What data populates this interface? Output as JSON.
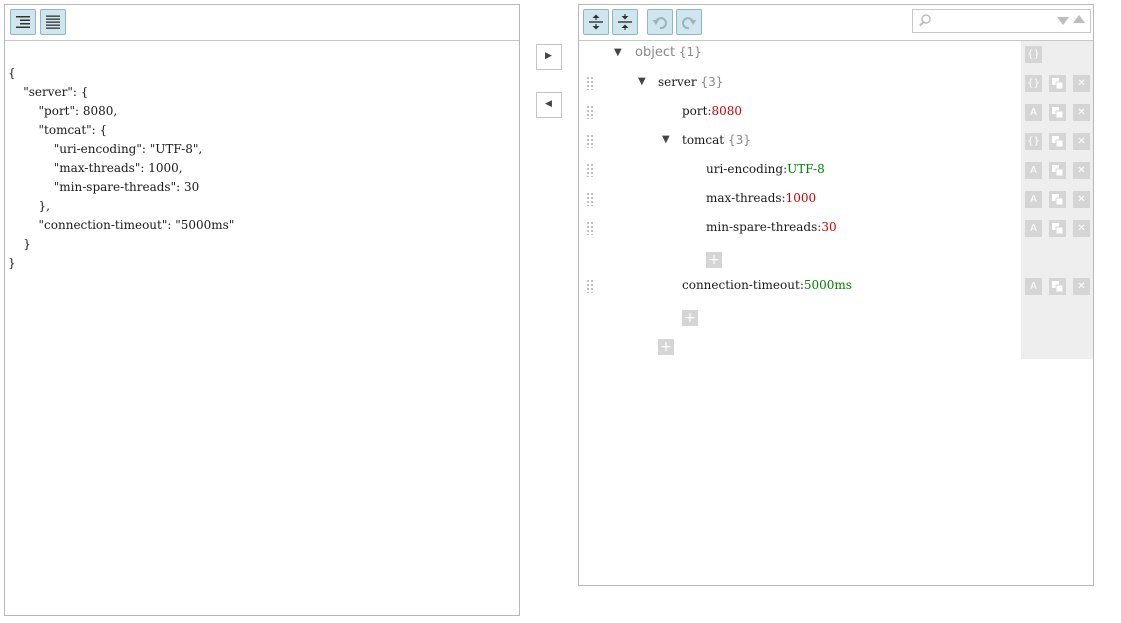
{
  "code_editor": {
    "lines": [
      "{",
      "    \"server\": {",
      "        \"port\": 8080,",
      "        \"tomcat\": {",
      "            \"uri-encoding\": \"UTF-8\",",
      "            \"max-threads\": 1000,",
      "            \"min-spare-threads\": 30",
      "        },",
      "        \"connection-timeout\": \"5000ms\"",
      "    }",
      "}"
    ]
  },
  "transfer": {
    "to_tree_icon": "play-right-icon",
    "to_code_icon": "play-left-icon",
    "to_tree_glyph": "▶",
    "to_code_glyph": "◀"
  },
  "tree_toolbar": {
    "search_placeholder": ""
  },
  "tree": {
    "root": {
      "key": "object",
      "count": "{1}"
    },
    "server": {
      "key": "server",
      "count": "{3}"
    },
    "port": {
      "key": "port",
      "value": "8080"
    },
    "tomcat": {
      "key": "tomcat",
      "count": "{3}"
    },
    "uri_encoding": {
      "key": "uri-encoding",
      "value": "UTF-8"
    },
    "max_threads": {
      "key": "max-threads",
      "value": "1000"
    },
    "min_spare_threads": {
      "key": "min-spare-threads",
      "value": "30"
    },
    "connection_timeout": {
      "key": "connection-timeout",
      "value": "5000ms"
    },
    "colon": ":",
    "object_type_glyph": "{}",
    "value_type_glyph": "A",
    "delete_glyph": "✕",
    "add_glyph": "+",
    "expanded_glyph": "▼"
  },
  "colors": {
    "number": "#cc0000",
    "string": "#008000",
    "toolbar_button": "#cfe6ee"
  }
}
